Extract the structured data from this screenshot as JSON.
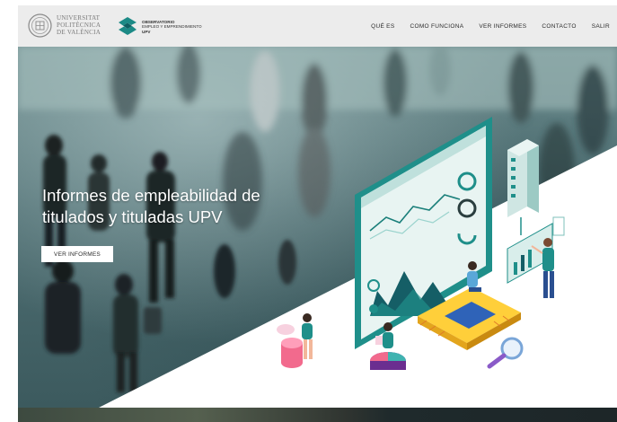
{
  "header": {
    "university_name_lines": [
      "UNIVERSITAT",
      "POLITÈCNICA",
      "DE VALÈNCIA"
    ],
    "observatory_name_lines": [
      "OBSERVATORIO",
      "EMPLEO Y EMPRENDIMIENTO",
      "UPV"
    ]
  },
  "nav": {
    "items": [
      {
        "label": "QUÉ ES"
      },
      {
        "label": "COMO FUNCIONA"
      },
      {
        "label": "VER INFORMES"
      },
      {
        "label": "CONTACTO"
      },
      {
        "label": "SALIR"
      }
    ]
  },
  "hero": {
    "title": "Informes de empleabilidad de titulados y tituladas UPV",
    "button_label": "VER INFORMES"
  },
  "colors": {
    "accent_teal": "#1f8f8a",
    "dark_teal": "#155e66",
    "hero_overlay": "#4e6e72",
    "button_bg": "#ffffff"
  },
  "icons": {
    "university_seal": "upv-seal-icon",
    "observatory_mark": "observatory-logo-icon"
  }
}
